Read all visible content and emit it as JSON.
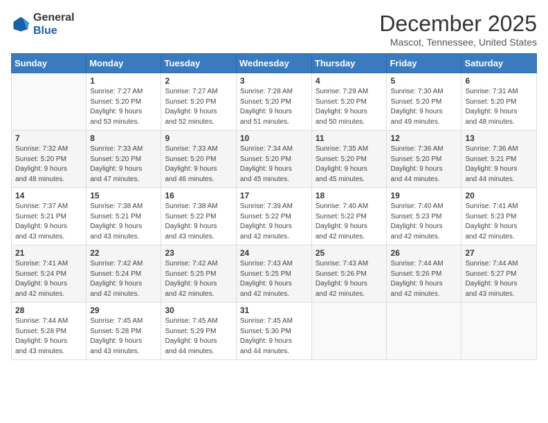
{
  "header": {
    "logo_general": "General",
    "logo_blue": "Blue",
    "month_title": "December 2025",
    "location": "Mascot, Tennessee, United States"
  },
  "days_of_week": [
    "Sunday",
    "Monday",
    "Tuesday",
    "Wednesday",
    "Thursday",
    "Friday",
    "Saturday"
  ],
  "weeks": [
    [
      {
        "day": "",
        "info": ""
      },
      {
        "day": "1",
        "info": "Sunrise: 7:27 AM\nSunset: 5:20 PM\nDaylight: 9 hours\nand 53 minutes."
      },
      {
        "day": "2",
        "info": "Sunrise: 7:27 AM\nSunset: 5:20 PM\nDaylight: 9 hours\nand 52 minutes."
      },
      {
        "day": "3",
        "info": "Sunrise: 7:28 AM\nSunset: 5:20 PM\nDaylight: 9 hours\nand 51 minutes."
      },
      {
        "day": "4",
        "info": "Sunrise: 7:29 AM\nSunset: 5:20 PM\nDaylight: 9 hours\nand 50 minutes."
      },
      {
        "day": "5",
        "info": "Sunrise: 7:30 AM\nSunset: 5:20 PM\nDaylight: 9 hours\nand 49 minutes."
      },
      {
        "day": "6",
        "info": "Sunrise: 7:31 AM\nSunset: 5:20 PM\nDaylight: 9 hours\nand 48 minutes."
      }
    ],
    [
      {
        "day": "7",
        "info": "Sunrise: 7:32 AM\nSunset: 5:20 PM\nDaylight: 9 hours\nand 48 minutes."
      },
      {
        "day": "8",
        "info": "Sunrise: 7:33 AM\nSunset: 5:20 PM\nDaylight: 9 hours\nand 47 minutes."
      },
      {
        "day": "9",
        "info": "Sunrise: 7:33 AM\nSunset: 5:20 PM\nDaylight: 9 hours\nand 46 minutes."
      },
      {
        "day": "10",
        "info": "Sunrise: 7:34 AM\nSunset: 5:20 PM\nDaylight: 9 hours\nand 45 minutes."
      },
      {
        "day": "11",
        "info": "Sunrise: 7:35 AM\nSunset: 5:20 PM\nDaylight: 9 hours\nand 45 minutes."
      },
      {
        "day": "12",
        "info": "Sunrise: 7:36 AM\nSunset: 5:20 PM\nDaylight: 9 hours\nand 44 minutes."
      },
      {
        "day": "13",
        "info": "Sunrise: 7:36 AM\nSunset: 5:21 PM\nDaylight: 9 hours\nand 44 minutes."
      }
    ],
    [
      {
        "day": "14",
        "info": "Sunrise: 7:37 AM\nSunset: 5:21 PM\nDaylight: 9 hours\nand 43 minutes."
      },
      {
        "day": "15",
        "info": "Sunrise: 7:38 AM\nSunset: 5:21 PM\nDaylight: 9 hours\nand 43 minutes."
      },
      {
        "day": "16",
        "info": "Sunrise: 7:38 AM\nSunset: 5:22 PM\nDaylight: 9 hours\nand 43 minutes."
      },
      {
        "day": "17",
        "info": "Sunrise: 7:39 AM\nSunset: 5:22 PM\nDaylight: 9 hours\nand 42 minutes."
      },
      {
        "day": "18",
        "info": "Sunrise: 7:40 AM\nSunset: 5:22 PM\nDaylight: 9 hours\nand 42 minutes."
      },
      {
        "day": "19",
        "info": "Sunrise: 7:40 AM\nSunset: 5:23 PM\nDaylight: 9 hours\nand 42 minutes."
      },
      {
        "day": "20",
        "info": "Sunrise: 7:41 AM\nSunset: 5:23 PM\nDaylight: 9 hours\nand 42 minutes."
      }
    ],
    [
      {
        "day": "21",
        "info": "Sunrise: 7:41 AM\nSunset: 5:24 PM\nDaylight: 9 hours\nand 42 minutes."
      },
      {
        "day": "22",
        "info": "Sunrise: 7:42 AM\nSunset: 5:24 PM\nDaylight: 9 hours\nand 42 minutes."
      },
      {
        "day": "23",
        "info": "Sunrise: 7:42 AM\nSunset: 5:25 PM\nDaylight: 9 hours\nand 42 minutes."
      },
      {
        "day": "24",
        "info": "Sunrise: 7:43 AM\nSunset: 5:25 PM\nDaylight: 9 hours\nand 42 minutes."
      },
      {
        "day": "25",
        "info": "Sunrise: 7:43 AM\nSunset: 5:26 PM\nDaylight: 9 hours\nand 42 minutes."
      },
      {
        "day": "26",
        "info": "Sunrise: 7:44 AM\nSunset: 5:26 PM\nDaylight: 9 hours\nand 42 minutes."
      },
      {
        "day": "27",
        "info": "Sunrise: 7:44 AM\nSunset: 5:27 PM\nDaylight: 9 hours\nand 43 minutes."
      }
    ],
    [
      {
        "day": "28",
        "info": "Sunrise: 7:44 AM\nSunset: 5:28 PM\nDaylight: 9 hours\nand 43 minutes."
      },
      {
        "day": "29",
        "info": "Sunrise: 7:45 AM\nSunset: 5:28 PM\nDaylight: 9 hours\nand 43 minutes."
      },
      {
        "day": "30",
        "info": "Sunrise: 7:45 AM\nSunset: 5:29 PM\nDaylight: 9 hours\nand 44 minutes."
      },
      {
        "day": "31",
        "info": "Sunrise: 7:45 AM\nSunset: 5:30 PM\nDaylight: 9 hours\nand 44 minutes."
      },
      {
        "day": "",
        "info": ""
      },
      {
        "day": "",
        "info": ""
      },
      {
        "day": "",
        "info": ""
      }
    ]
  ]
}
